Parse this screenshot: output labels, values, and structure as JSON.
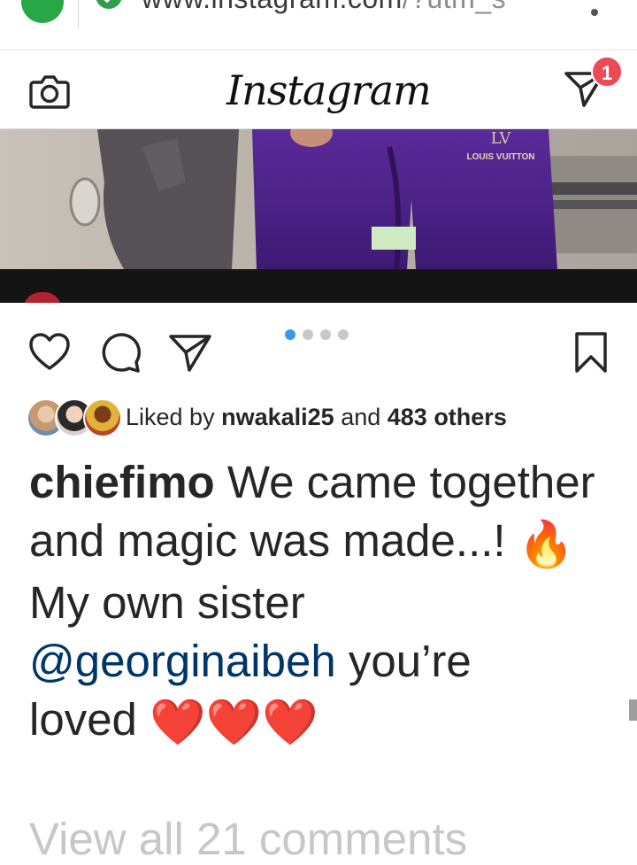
{
  "browser": {
    "url_domain": "www.instagram.com",
    "url_path": "/?utm_s",
    "lens_icon": "lens-icon",
    "lock_icon": "secure-lock-icon",
    "menu_icon": "more-vert-icon"
  },
  "header": {
    "logo_text": "Instagram",
    "camera_icon": "camera-icon",
    "direct_icon": "direct-message-icon",
    "direct_badge": "1",
    "badge_color": "#ed4956"
  },
  "post": {
    "photo_brand_text": "LOUIS VUITTON",
    "actions": {
      "like_icon": "heart-icon",
      "comment_icon": "comment-icon",
      "share_icon": "share-icon",
      "save_icon": "bookmark-icon"
    },
    "carousel": {
      "count": 4,
      "active_index": 0,
      "active_color": "#3897f0"
    },
    "likes": {
      "prefix": "Liked by",
      "user": "nwakali25",
      "connector": "and",
      "others": "483 others"
    },
    "caption": {
      "username": "chiefimo",
      "line1": "We came together and magic was made...!",
      "fire": "🔥",
      "line2": "My own sister",
      "mention": "@georginaibeh",
      "line3_tail": "you’re",
      "line4": "loved",
      "hearts": [
        "❤️",
        "❤️",
        "❤️"
      ]
    },
    "view_comments": "View all 21 comments",
    "mention_color": "#003569"
  }
}
